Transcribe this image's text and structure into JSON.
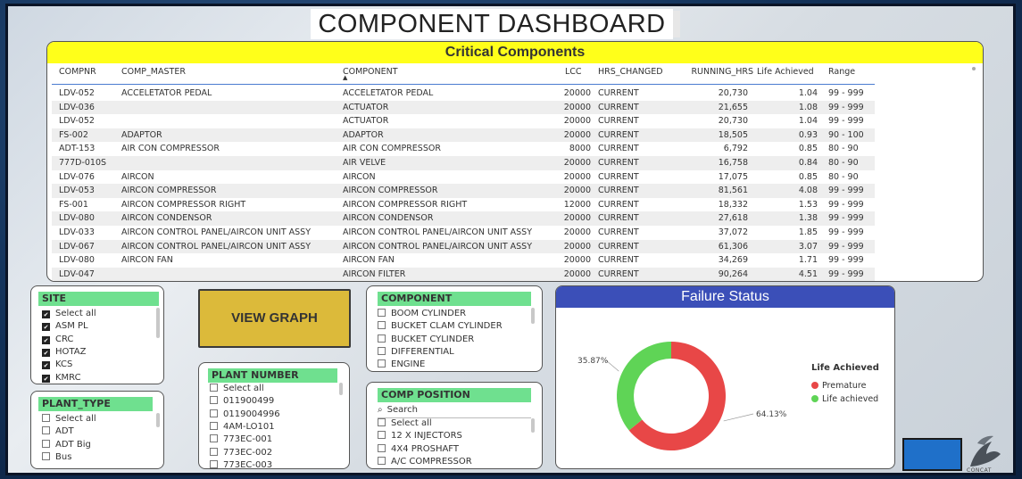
{
  "header": {
    "title": "COMPONENT DASHBOARD"
  },
  "table": {
    "title": "Critical Components",
    "columns": [
      "COMPNR",
      "COMP_MASTER",
      "COMPONENT",
      "LCC",
      "HRS_CHANGED",
      "RUNNING_HRS",
      "Life Achieved",
      "Range"
    ],
    "rows": [
      [
        "LDV-052",
        "ACCELETATOR PEDAL",
        "ACCELETATOR PEDAL",
        "20000",
        "CURRENT",
        "20,730",
        "1.04",
        "99 - 999"
      ],
      [
        "LDV-036",
        "",
        "ACTUATOR",
        "20000",
        "CURRENT",
        "21,655",
        "1.08",
        "99 - 999"
      ],
      [
        "LDV-052",
        "",
        "ACTUATOR",
        "20000",
        "CURRENT",
        "20,730",
        "1.04",
        "99 - 999"
      ],
      [
        "FS-002",
        "ADAPTOR",
        "ADAPTOR",
        "20000",
        "CURRENT",
        "18,505",
        "0.93",
        "90 - 100"
      ],
      [
        "ADT-153",
        "AIR CON COMPRESSOR",
        "AIR CON COMPRESSOR",
        "8000",
        "CURRENT",
        "6,792",
        "0.85",
        "80 - 90"
      ],
      [
        "777D-010S",
        "",
        "AIR VELVE",
        "20000",
        "CURRENT",
        "16,758",
        "0.84",
        "80 - 90"
      ],
      [
        "LDV-076",
        "AIRCON",
        "AIRCON",
        "20000",
        "CURRENT",
        "17,075",
        "0.85",
        "80 - 90"
      ],
      [
        "LDV-053",
        "AIRCON COMPRESSOR",
        "AIRCON COMPRESSOR",
        "20000",
        "CURRENT",
        "81,561",
        "4.08",
        "99 - 999"
      ],
      [
        "FS-001",
        "AIRCON COMPRESSOR RIGHT",
        "AIRCON COMPRESSOR RIGHT",
        "12000",
        "CURRENT",
        "18,332",
        "1.53",
        "99 - 999"
      ],
      [
        "LDV-080",
        "AIRCON CONDENSOR",
        "AIRCON CONDENSOR",
        "20000",
        "CURRENT",
        "27,618",
        "1.38",
        "99 - 999"
      ],
      [
        "LDV-033",
        "AIRCON CONTROL PANEL/AIRCON UNIT ASSY",
        "AIRCON CONTROL PANEL/AIRCON UNIT ASSY",
        "20000",
        "CURRENT",
        "37,072",
        "1.85",
        "99 - 999"
      ],
      [
        "LDV-067",
        "AIRCON CONTROL PANEL/AIRCON UNIT ASSY",
        "AIRCON CONTROL PANEL/AIRCON UNIT ASSY",
        "20000",
        "CURRENT",
        "61,306",
        "3.07",
        "99 - 999"
      ],
      [
        "LDV-080",
        "AIRCON FAN",
        "AIRCON FAN",
        "20000",
        "CURRENT",
        "34,269",
        "1.71",
        "99 - 999"
      ],
      [
        "LDV-047",
        "",
        "AIRCON FILTER",
        "20000",
        "CURRENT",
        "90,264",
        "4.51",
        "99 - 999"
      ]
    ]
  },
  "site": {
    "title": "SITE",
    "items": [
      {
        "label": "Select all",
        "checked": true
      },
      {
        "label": "ASM PL",
        "checked": true
      },
      {
        "label": "CRC",
        "checked": true
      },
      {
        "label": "HOTAZ",
        "checked": true
      },
      {
        "label": "KCS",
        "checked": true
      },
      {
        "label": "KMRC",
        "checked": true
      }
    ]
  },
  "plant_type": {
    "title": "PLANT_TYPE",
    "items": [
      {
        "label": "Select all",
        "checked": false
      },
      {
        "label": "ADT",
        "checked": false
      },
      {
        "label": "ADT Big",
        "checked": false
      },
      {
        "label": "Bus",
        "checked": false
      }
    ]
  },
  "view_graph": {
    "label": "VIEW GRAPH"
  },
  "plant_number": {
    "title": "PLANT NUMBER",
    "items": [
      {
        "label": "Select all",
        "checked": false
      },
      {
        "label": "011900499",
        "checked": false
      },
      {
        "label": "0119004996",
        "checked": false
      },
      {
        "label": "4AM-LO101",
        "checked": false
      },
      {
        "label": "773EC-001",
        "checked": false
      },
      {
        "label": "773EC-002",
        "checked": false
      },
      {
        "label": "773EC-003",
        "checked": false
      }
    ]
  },
  "component": {
    "title": "COMPONENT",
    "items": [
      {
        "label": "BOOM CYLINDER",
        "checked": false
      },
      {
        "label": "BUCKET CLAM CYLINDER",
        "checked": false
      },
      {
        "label": "BUCKET CYLINDER",
        "checked": false
      },
      {
        "label": "DIFFERENTIAL",
        "checked": false
      },
      {
        "label": "ENGINE",
        "checked": false
      }
    ]
  },
  "comp_position": {
    "title": "COMP POSITION",
    "search_placeholder": "Search",
    "items": [
      {
        "label": "Select all",
        "checked": false
      },
      {
        "label": "12 X INJECTORS",
        "checked": false
      },
      {
        "label": "4X4 PROSHAFT",
        "checked": false
      },
      {
        "label": "A/C COMPRESSOR",
        "checked": false
      }
    ]
  },
  "failure_status": {
    "title": "Failure Status",
    "legend_title": "Life Achieved"
  },
  "chart_data": {
    "type": "pie",
    "title": "Failure Status",
    "legend_title": "Life Achieved",
    "donut": true,
    "series": [
      {
        "name": "Premature",
        "value": 64.13,
        "label": "64.13%",
        "color": "#e84747"
      },
      {
        "name": "Life achieved",
        "value": 35.87,
        "label": "35.87%",
        "color": "#5fd456"
      }
    ]
  },
  "logo": {
    "text": "CONCAT"
  }
}
